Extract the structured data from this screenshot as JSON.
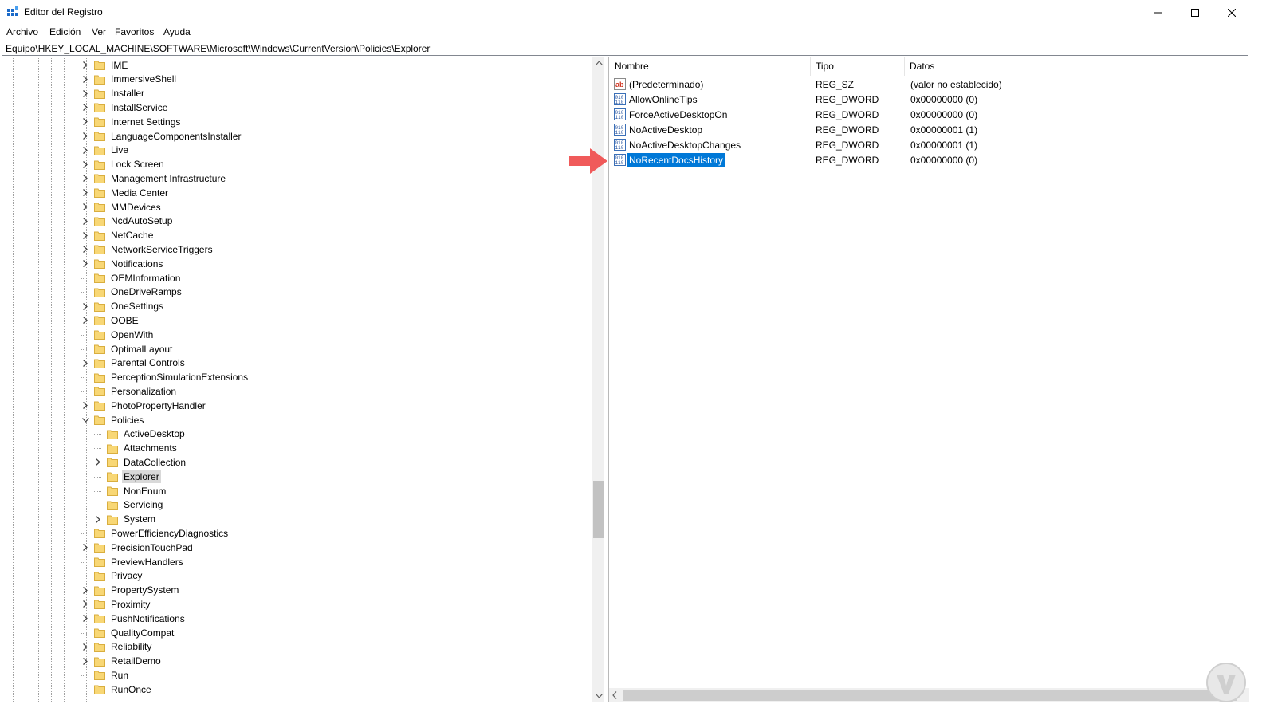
{
  "window": {
    "title": "Editor del Registro",
    "controls": [
      "minimize-icon",
      "maximize-icon",
      "close-icon"
    ]
  },
  "menu": {
    "items": [
      "Archivo",
      "Edición",
      "Ver",
      "Favoritos",
      "Ayuda"
    ]
  },
  "address": {
    "path": "Equipo\\HKEY_LOCAL_MACHINE\\SOFTWARE\\Microsoft\\Windows\\CurrentVersion\\Policies\\Explorer"
  },
  "tree": {
    "items": [
      {
        "label": "IME",
        "expandable": true,
        "level": 1
      },
      {
        "label": "ImmersiveShell",
        "expandable": true,
        "level": 1
      },
      {
        "label": "Installer",
        "expandable": true,
        "level": 1
      },
      {
        "label": "InstallService",
        "expandable": true,
        "level": 1
      },
      {
        "label": "Internet Settings",
        "expandable": true,
        "level": 1
      },
      {
        "label": "LanguageComponentsInstaller",
        "expandable": true,
        "level": 1
      },
      {
        "label": "Live",
        "expandable": true,
        "level": 1
      },
      {
        "label": "Lock Screen",
        "expandable": true,
        "level": 1
      },
      {
        "label": "Management Infrastructure",
        "expandable": true,
        "level": 1
      },
      {
        "label": "Media Center",
        "expandable": true,
        "level": 1
      },
      {
        "label": "MMDevices",
        "expandable": true,
        "level": 1
      },
      {
        "label": "NcdAutoSetup",
        "expandable": true,
        "level": 1
      },
      {
        "label": "NetCache",
        "expandable": true,
        "level": 1
      },
      {
        "label": "NetworkServiceTriggers",
        "expandable": true,
        "level": 1
      },
      {
        "label": "Notifications",
        "expandable": true,
        "level": 1
      },
      {
        "label": "OEMInformation",
        "expandable": false,
        "level": 1
      },
      {
        "label": "OneDriveRamps",
        "expandable": false,
        "level": 1
      },
      {
        "label": "OneSettings",
        "expandable": true,
        "level": 1
      },
      {
        "label": "OOBE",
        "expandable": true,
        "level": 1
      },
      {
        "label": "OpenWith",
        "expandable": false,
        "level": 1
      },
      {
        "label": "OptimalLayout",
        "expandable": false,
        "level": 1
      },
      {
        "label": "Parental Controls",
        "expandable": true,
        "level": 1
      },
      {
        "label": "PerceptionSimulationExtensions",
        "expandable": false,
        "level": 1
      },
      {
        "label": "Personalization",
        "expandable": false,
        "level": 1
      },
      {
        "label": "PhotoPropertyHandler",
        "expandable": true,
        "level": 1
      },
      {
        "label": "Policies",
        "expandable": true,
        "expanded": true,
        "level": 1
      },
      {
        "label": "ActiveDesktop",
        "expandable": false,
        "level": 2
      },
      {
        "label": "Attachments",
        "expandable": false,
        "level": 2
      },
      {
        "label": "DataCollection",
        "expandable": true,
        "level": 2
      },
      {
        "label": "Explorer",
        "expandable": false,
        "level": 2,
        "selected": true
      },
      {
        "label": "NonEnum",
        "expandable": false,
        "level": 2
      },
      {
        "label": "Servicing",
        "expandable": false,
        "level": 2
      },
      {
        "label": "System",
        "expandable": true,
        "level": 2
      },
      {
        "label": "PowerEfficiencyDiagnostics",
        "expandable": false,
        "level": 1
      },
      {
        "label": "PrecisionTouchPad",
        "expandable": true,
        "level": 1
      },
      {
        "label": "PreviewHandlers",
        "expandable": false,
        "level": 1
      },
      {
        "label": "Privacy",
        "expandable": false,
        "level": 1
      },
      {
        "label": "PropertySystem",
        "expandable": true,
        "level": 1
      },
      {
        "label": "Proximity",
        "expandable": true,
        "level": 1
      },
      {
        "label": "PushNotifications",
        "expandable": true,
        "level": 1
      },
      {
        "label": "QualityCompat",
        "expandable": false,
        "level": 1
      },
      {
        "label": "Reliability",
        "expandable": true,
        "level": 1
      },
      {
        "label": "RetailDemo",
        "expandable": true,
        "level": 1
      },
      {
        "label": "Run",
        "expandable": false,
        "level": 1
      },
      {
        "label": "RunOnce",
        "expandable": false,
        "level": 1
      }
    ]
  },
  "list": {
    "columns": {
      "name": "Nombre",
      "type": "Tipo",
      "data": "Datos"
    },
    "rows": [
      {
        "name": "(Predeterminado)",
        "type": "REG_SZ",
        "data": "(valor no establecido)",
        "icon": "reg-sz-icon"
      },
      {
        "name": "AllowOnlineTips",
        "type": "REG_DWORD",
        "data": "0x00000000 (0)",
        "icon": "reg-dword-icon"
      },
      {
        "name": "ForceActiveDesktopOn",
        "type": "REG_DWORD",
        "data": "0x00000000 (0)",
        "icon": "reg-dword-icon"
      },
      {
        "name": "NoActiveDesktop",
        "type": "REG_DWORD",
        "data": "0x00000001 (1)",
        "icon": "reg-dword-icon"
      },
      {
        "name": "NoActiveDesktopChanges",
        "type": "REG_DWORD",
        "data": "0x00000001 (1)",
        "icon": "reg-dword-icon"
      },
      {
        "name": "NoRecentDocsHistory",
        "type": "REG_DWORD",
        "data": "0x00000000 (0)",
        "icon": "reg-dword-icon",
        "selected": true
      }
    ]
  },
  "colors": {
    "selection": "#0078d7",
    "folder": "#f8d775",
    "arrow": "#f05a5a"
  }
}
